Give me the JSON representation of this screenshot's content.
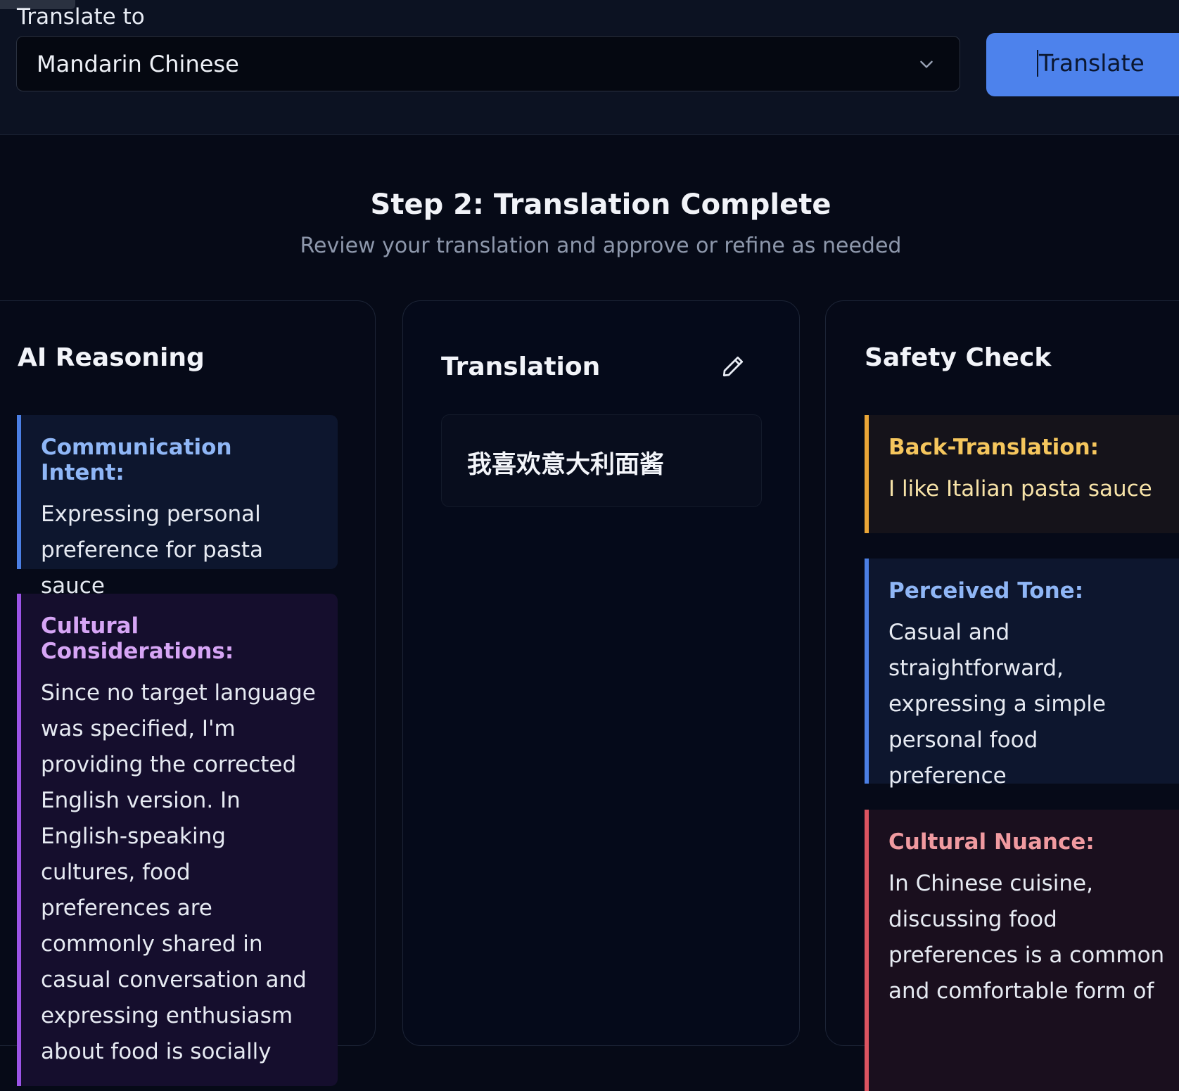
{
  "language_selector": {
    "label": "Translate to",
    "selected": "Mandarin Chinese",
    "action_label": "Translate"
  },
  "step": {
    "title": "Step 2: Translation Complete",
    "subtitle": "Review your translation and approve or refine as needed"
  },
  "reasoning_panel": {
    "title": "AI Reasoning",
    "cards": [
      {
        "heading": "Communication Intent:",
        "body": "Expressing personal preference for pasta sauce"
      },
      {
        "heading": "Cultural Considerations:",
        "body": "Since no target language was specified, I'm providing the corrected English version. In English-speaking cultures, food preferences are commonly shared in casual conversation and expressing enthusiasm about food is socially"
      }
    ]
  },
  "translation_panel": {
    "title": "Translation",
    "text": "我喜欢意大利面酱",
    "edit_icon": "pencil-icon"
  },
  "safety_panel": {
    "title": "Safety Check",
    "cards": [
      {
        "heading": "Back-Translation:",
        "body": "I like Italian pasta sauce"
      },
      {
        "heading": "Perceived Tone:",
        "body": "Casual and straightforward, expressing a simple personal food preference"
      },
      {
        "heading": "Cultural Nuance:",
        "body": "In Chinese cuisine, discussing food preferences is a common and comfortable form of"
      }
    ]
  },
  "colors": {
    "accent_blue": "#4d82ec",
    "intent_blue": "#4b7fe4",
    "cultural_purple": "#9b54e6",
    "backtranslation_amber": "#eaa637",
    "nuance_red": "#dc5460"
  }
}
